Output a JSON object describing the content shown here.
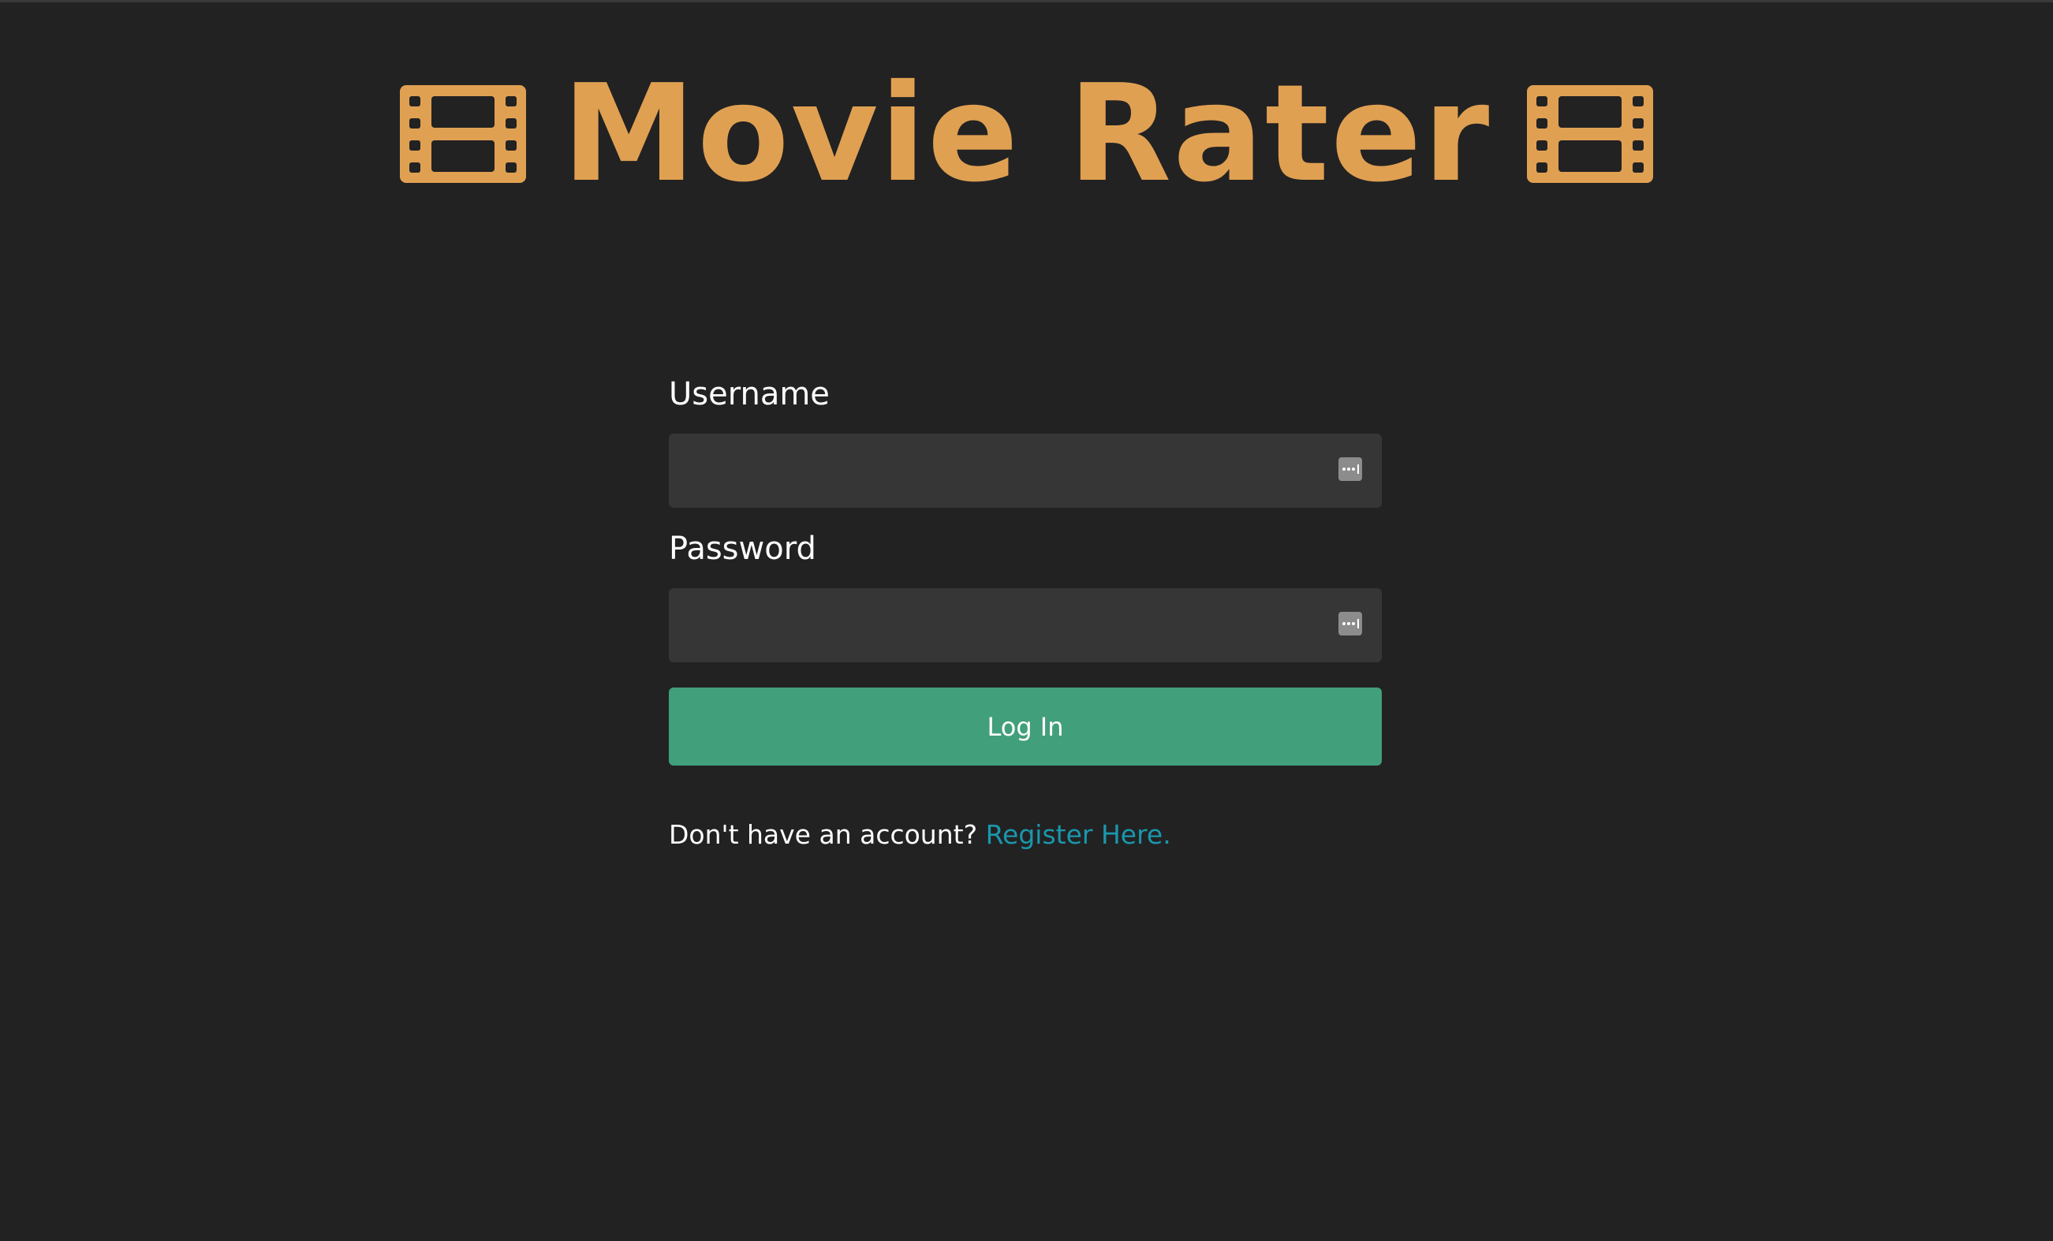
{
  "app": {
    "title": "Movie Rater",
    "icons": [
      "film-icon",
      "film-icon"
    ],
    "colors": {
      "background": "#222222",
      "title": "#e0a052",
      "input_background": "#363636",
      "button": "#429f7b",
      "link": "#1a97ad"
    }
  },
  "form": {
    "username_label": "Username",
    "username_value": "",
    "password_label": "Password",
    "password_value": "",
    "field_icon": "password-manager-icon",
    "login_label": "Log In"
  },
  "register": {
    "prompt": "Don't have an account?",
    "link_label": "Register Here."
  }
}
